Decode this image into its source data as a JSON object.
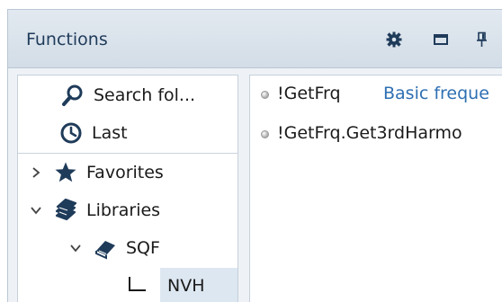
{
  "panel": {
    "title": "Functions",
    "toolbar_icons": [
      "gear-icon",
      "maximize-icon",
      "pin-icon"
    ]
  },
  "tree": {
    "items": [
      {
        "label": "Search fol...",
        "icon": "search-icon"
      },
      {
        "label": "Last",
        "icon": "clock-icon"
      },
      {
        "label": "Favorites",
        "icon": "star-icon",
        "expander": "collapsed"
      },
      {
        "label": "Libraries",
        "icon": "books-icon",
        "expander": "expanded"
      },
      {
        "label": "SQF",
        "icon": "book-icon",
        "expander": "expanded"
      },
      {
        "label": "NVH",
        "icon": "tree-connector-icon",
        "selected": true
      }
    ]
  },
  "functions": {
    "rows": [
      {
        "name": "!GetFrq",
        "description": "Basic freque"
      },
      {
        "name": "!GetFrq.Get3rdHarmo",
        "description": ""
      }
    ]
  },
  "colors": {
    "accent_dark": "#1f3b5a",
    "link_blue": "#2e6fb3",
    "selection": "#dde7f1"
  }
}
